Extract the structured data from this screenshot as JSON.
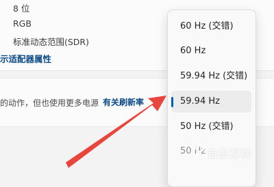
{
  "display_info": {
    "bit_depth": "8 位",
    "color_format": "RGB",
    "color_space": "标准动态范围(SDR)",
    "adapter_link": "示适配器属性"
  },
  "refresh_section": {
    "description": "的动作，但也使用更多电源",
    "learn_more_link": "有关刷新率"
  },
  "refresh_dropdown": {
    "options": [
      {
        "label": "60 Hz (交错)"
      },
      {
        "label": "60 Hz"
      },
      {
        "label": "59.94 Hz (交错)"
      },
      {
        "label": "59.94 Hz",
        "selected": true
      },
      {
        "label": "50 Hz (交错)"
      },
      {
        "label": "50 Hz"
      }
    ]
  },
  "colors": {
    "accent": "#005fb8",
    "arrow": "#e8453c",
    "link": "#0a4a86"
  },
  "watermark": "自由互联"
}
